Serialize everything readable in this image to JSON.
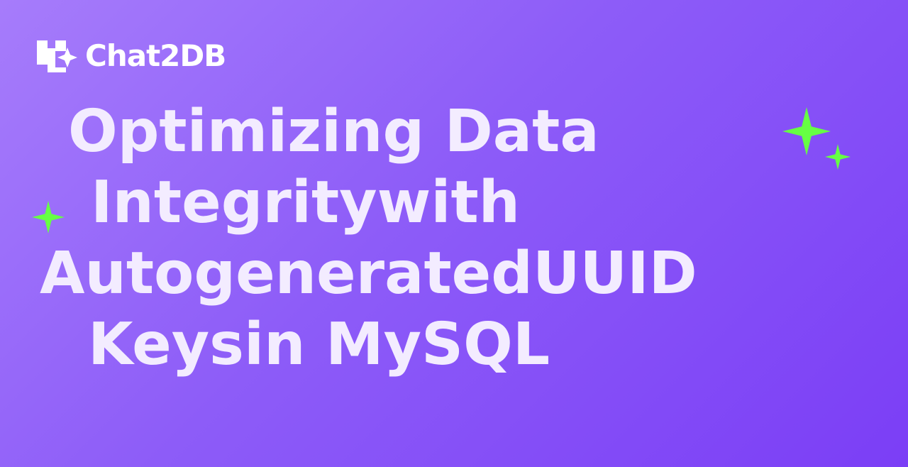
{
  "brand": {
    "logo_icon": "chat2db-logo-icon",
    "name": "Chat2DB"
  },
  "title": {
    "lines": [
      "Optimizing Data",
      "Integritywith",
      "AutogeneratedUUID",
      "Keysin MySQL"
    ]
  },
  "decorations": {
    "sparkle_icon": "sparkle-icon",
    "sparkle_color": "#66ff44"
  },
  "colors": {
    "background_start": "#a67cfb",
    "background_end": "#7b3ef6",
    "title_text": "#f3ecff",
    "brand_text": "#ffffff"
  }
}
